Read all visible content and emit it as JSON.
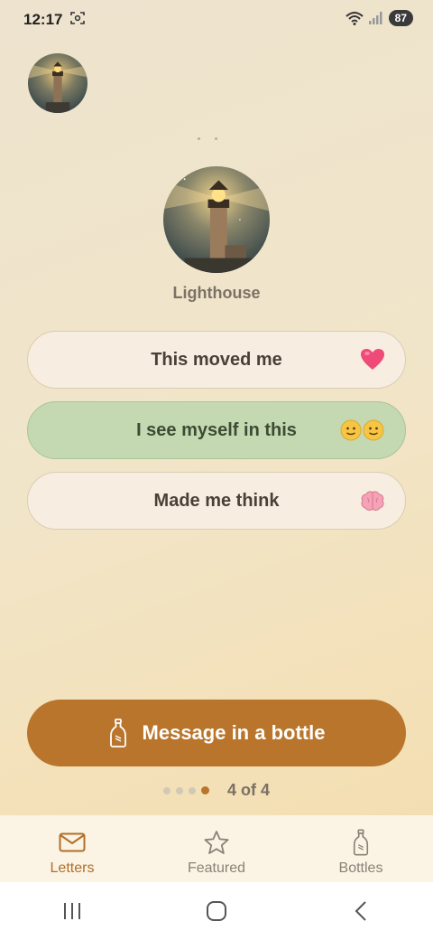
{
  "status_bar": {
    "time": "12:17",
    "battery": "87"
  },
  "author": {
    "name": "Lighthouse"
  },
  "reactions": [
    {
      "label": "This moved me",
      "emoji": "heart-icon",
      "selected": false
    },
    {
      "label": "I see myself in this",
      "emoji": "smiley-faces-icon",
      "selected": true
    },
    {
      "label": "Made me think",
      "emoji": "brain-icon",
      "selected": false
    }
  ],
  "cta": {
    "label": "Message in a bottle",
    "icon": "bottle-icon"
  },
  "pager": {
    "label": "4 of 4",
    "current": 4,
    "total": 4
  },
  "bottom_nav": {
    "items": [
      {
        "label": "Letters",
        "icon": "envelope-icon",
        "active": true
      },
      {
        "label": "Featured",
        "icon": "star-icon",
        "active": false
      },
      {
        "label": "Bottles",
        "icon": "bottle-icon",
        "active": false
      }
    ]
  },
  "colors": {
    "accent": "#b9752b",
    "selected_bg": "#c4d9b2",
    "card_bg": "#f7ede0"
  }
}
